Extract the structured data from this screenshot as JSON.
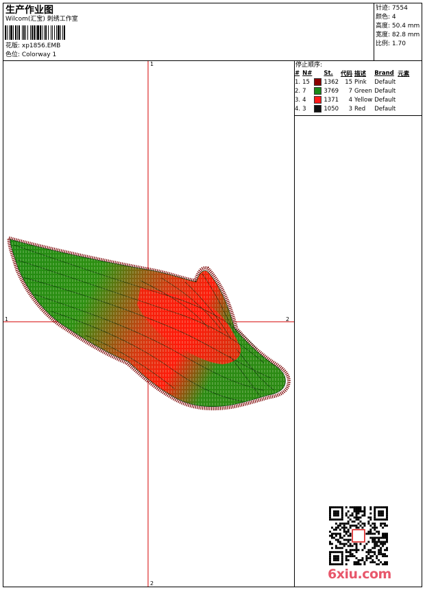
{
  "header": {
    "title": "生产作业图",
    "company": "Wilcom(汇宝) 刺绣工作室",
    "design_label": "花版: xp1856.EMB",
    "colorway_label": "色位: Colorway 1"
  },
  "stats": {
    "stitches": "针迹: 7554",
    "colors": "颜色: 4",
    "height": "高度: 50.4 mm",
    "width": "宽度: 82.8 mm",
    "scale": "比例: 1.70"
  },
  "canvas": {
    "axis_labels": {
      "v_top": "1",
      "v_bottom": "2",
      "h_left": "1",
      "h_right": "2"
    },
    "axis_color": "#d40000"
  },
  "stop_sequence": {
    "title": "停止顺序:",
    "headers": [
      "#",
      "N#",
      "St.",
      "代码",
      "描述",
      "Brand",
      "元素"
    ],
    "rows": [
      {
        "num": "1.",
        "needle": "15",
        "swatch": "#8b0000",
        "stitches": "1362",
        "code": "15",
        "desc": "Pink",
        "brand": "Default"
      },
      {
        "num": "2.",
        "needle": "7",
        "swatch": "#1a8a1a",
        "stitches": "3769",
        "code": "7",
        "desc": "Green",
        "brand": "Default"
      },
      {
        "num": "3.",
        "needle": "4",
        "swatch": "#ff1a1a",
        "stitches": "1371",
        "code": "4",
        "desc": "Yellow",
        "brand": "Default"
      },
      {
        "num": "4.",
        "needle": "3",
        "swatch": "#111111",
        "stitches": "1050",
        "code": "3",
        "desc": "Red",
        "brand": "Default"
      }
    ]
  },
  "watermark": {
    "text": "6xiu.com",
    "color": "#e8576b"
  },
  "colors": {
    "wing_green": "#1f8a12",
    "wing_red": "#ff1a0a",
    "wing_edge": "#7a0000"
  }
}
